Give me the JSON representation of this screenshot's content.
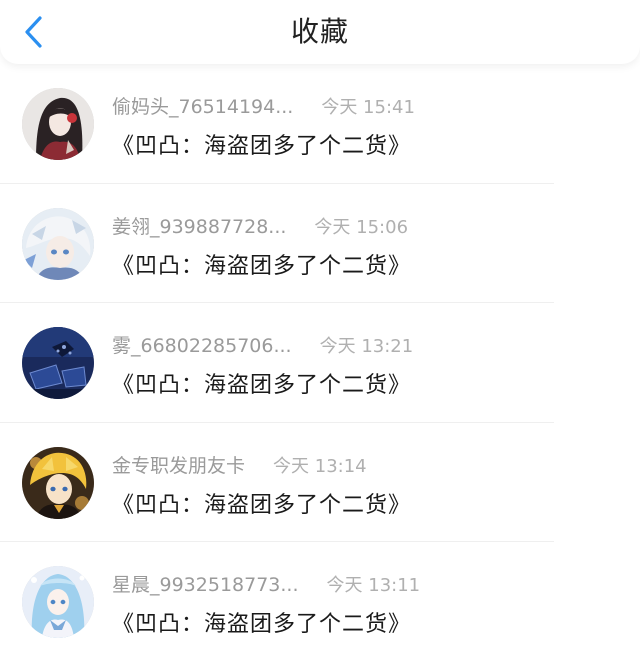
{
  "header": {
    "title": "收藏",
    "back_icon": "chevron-left-icon",
    "accent": "#2b8ff0"
  },
  "items": [
    {
      "name": "偷妈头_76514194...",
      "time": "今天 15:41",
      "message": "《凹凸：海盗团多了个二货》",
      "avatar": "anime-girl-dark-hair-avatar"
    },
    {
      "name": "姜翎_939887728...",
      "time": "今天 15:06",
      "message": "《凹凸：海盗团多了个二货》",
      "avatar": "anime-boy-white-hair-avatar"
    },
    {
      "name": "雾_66802285706...",
      "time": "今天 13:21",
      "message": "《凹凸：海盗团多了个二货》",
      "avatar": "dark-blue-scenery-avatar"
    },
    {
      "name": "金专职发朋友卡",
      "time": "今天 13:14",
      "message": "《凹凸：海盗团多了个二货》",
      "avatar": "anime-boy-blond-hair-avatar"
    },
    {
      "name": "星晨_9932518773...",
      "time": "今天 13:11",
      "message": "《凹凸：海盗团多了个二货》",
      "avatar": "anime-girl-light-blue-hair-avatar"
    }
  ]
}
